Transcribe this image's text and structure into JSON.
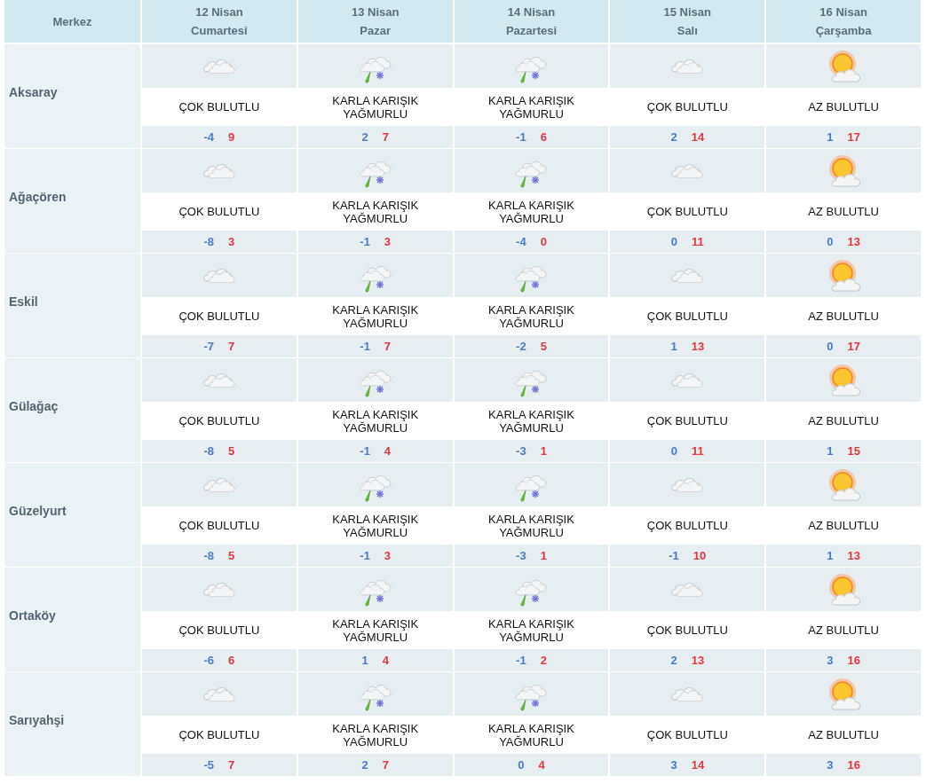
{
  "table": {
    "corner": "Merkez",
    "days": [
      {
        "date": "12 Nisan",
        "weekday": "Cumartesi"
      },
      {
        "date": "13 Nisan",
        "weekday": "Pazar"
      },
      {
        "date": "14 Nisan",
        "weekday": "Pazartesi"
      },
      {
        "date": "15 Nisan",
        "weekday": "Salı"
      },
      {
        "date": "16 Nisan",
        "weekday": "Çarşamba"
      }
    ],
    "rows": [
      {
        "name": "Aksaray",
        "forecasts": [
          {
            "kind": "cloudy",
            "condition": "ÇOK BULUTLU",
            "low": "-4",
            "high": "9"
          },
          {
            "kind": "sleet",
            "condition": "KARLA KARIŞIK YAĞMURLU",
            "low": "2",
            "high": "7"
          },
          {
            "kind": "sleet",
            "condition": "KARLA KARIŞIK YAĞMURLU",
            "low": "-1",
            "high": "6"
          },
          {
            "kind": "cloudy",
            "condition": "ÇOK BULUTLU",
            "low": "2",
            "high": "14"
          },
          {
            "kind": "sunny",
            "condition": "AZ BULUTLU",
            "low": "1",
            "high": "17"
          }
        ]
      },
      {
        "name": "Ağaçören",
        "forecasts": [
          {
            "kind": "cloudy",
            "condition": "ÇOK BULUTLU",
            "low": "-8",
            "high": "3"
          },
          {
            "kind": "sleet",
            "condition": "KARLA KARIŞIK YAĞMURLU",
            "low": "-1",
            "high": "3"
          },
          {
            "kind": "sleet",
            "condition": "KARLA KARIŞIK YAĞMURLU",
            "low": "-4",
            "high": "0"
          },
          {
            "kind": "cloudy",
            "condition": "ÇOK BULUTLU",
            "low": "0",
            "high": "11"
          },
          {
            "kind": "sunny",
            "condition": "AZ BULUTLU",
            "low": "0",
            "high": "13"
          }
        ]
      },
      {
        "name": "Eskil",
        "forecasts": [
          {
            "kind": "cloudy",
            "condition": "ÇOK BULUTLU",
            "low": "-7",
            "high": "7"
          },
          {
            "kind": "sleet",
            "condition": "KARLA KARIŞIK YAĞMURLU",
            "low": "-1",
            "high": "7"
          },
          {
            "kind": "sleet",
            "condition": "KARLA KARIŞIK YAĞMURLU",
            "low": "-2",
            "high": "5"
          },
          {
            "kind": "cloudy",
            "condition": "ÇOK BULUTLU",
            "low": "1",
            "high": "13"
          },
          {
            "kind": "sunny",
            "condition": "AZ BULUTLU",
            "low": "0",
            "high": "17"
          }
        ]
      },
      {
        "name": "Gülağaç",
        "forecasts": [
          {
            "kind": "cloudy",
            "condition": "ÇOK BULUTLU",
            "low": "-8",
            "high": "5"
          },
          {
            "kind": "sleet",
            "condition": "KARLA KARIŞIK YAĞMURLU",
            "low": "-1",
            "high": "4"
          },
          {
            "kind": "sleet",
            "condition": "KARLA KARIŞIK YAĞMURLU",
            "low": "-3",
            "high": "1"
          },
          {
            "kind": "cloudy",
            "condition": "ÇOK BULUTLU",
            "low": "0",
            "high": "11"
          },
          {
            "kind": "sunny",
            "condition": "AZ BULUTLU",
            "low": "1",
            "high": "15"
          }
        ]
      },
      {
        "name": "Güzelyurt",
        "forecasts": [
          {
            "kind": "cloudy",
            "condition": "ÇOK BULUTLU",
            "low": "-8",
            "high": "5"
          },
          {
            "kind": "sleet",
            "condition": "KARLA KARIŞIK YAĞMURLU",
            "low": "-1",
            "high": "3"
          },
          {
            "kind": "sleet",
            "condition": "KARLA KARIŞIK YAĞMURLU",
            "low": "-3",
            "high": "1"
          },
          {
            "kind": "cloudy",
            "condition": "ÇOK BULUTLU",
            "low": "-1",
            "high": "10"
          },
          {
            "kind": "sunny",
            "condition": "AZ BULUTLU",
            "low": "1",
            "high": "13"
          }
        ]
      },
      {
        "name": "Ortaköy",
        "forecasts": [
          {
            "kind": "cloudy",
            "condition": "ÇOK BULUTLU",
            "low": "-6",
            "high": "6"
          },
          {
            "kind": "sleet",
            "condition": "KARLA KARIŞIK YAĞMURLU",
            "low": "1",
            "high": "4"
          },
          {
            "kind": "sleet",
            "condition": "KARLA KARIŞIK YAĞMURLU",
            "low": "-1",
            "high": "2"
          },
          {
            "kind": "cloudy",
            "condition": "ÇOK BULUTLU",
            "low": "2",
            "high": "13"
          },
          {
            "kind": "sunny",
            "condition": "AZ BULUTLU",
            "low": "3",
            "high": "16"
          }
        ]
      },
      {
        "name": "Sarıyahşi",
        "forecasts": [
          {
            "kind": "cloudy",
            "condition": "ÇOK BULUTLU",
            "low": "-5",
            "high": "7"
          },
          {
            "kind": "sleet",
            "condition": "KARLA KARIŞIK YAĞMURLU",
            "low": "2",
            "high": "7"
          },
          {
            "kind": "sleet",
            "condition": "KARLA KARIŞIK YAĞMURLU",
            "low": "0",
            "high": "4"
          },
          {
            "kind": "cloudy",
            "condition": "ÇOK BULUTLU",
            "low": "3",
            "high": "14"
          },
          {
            "kind": "sunny",
            "condition": "AZ BULUTLU",
            "low": "3",
            "high": "16"
          }
        ]
      }
    ]
  }
}
